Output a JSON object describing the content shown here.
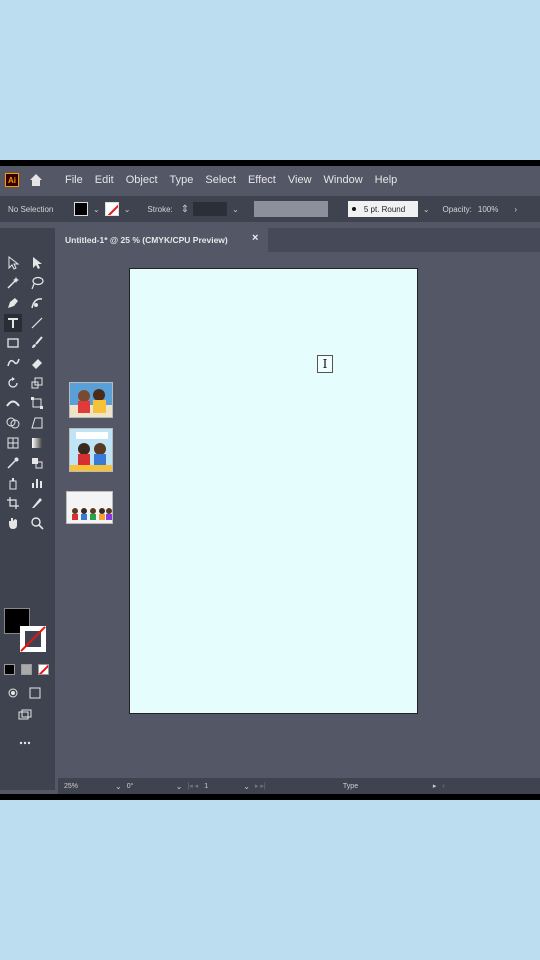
{
  "app": {
    "logo_text": "Ai",
    "menu": [
      "File",
      "Edit",
      "Object",
      "Type",
      "Select",
      "Effect",
      "View",
      "Window",
      "Help"
    ]
  },
  "control_bar": {
    "selection_label": "No Selection",
    "stroke_label": "Stroke:",
    "brush": "5 pt. Round",
    "opacity_label": "Opacity:",
    "opacity_value": "100%"
  },
  "document": {
    "tab_title": "Untitled-1* @ 25 % (CMYK/CPU Preview)",
    "close_glyph": "×"
  },
  "cursor": {
    "glyph": "I"
  },
  "status_bar": {
    "zoom": "25%",
    "rotation": "0°",
    "artboard_number": "1",
    "tool_name": "Type"
  },
  "icons": {
    "home": "home-icon",
    "tools": [
      "selection-tool-icon",
      "direct-selection-tool-icon",
      "magic-wand-icon",
      "lasso-icon",
      "pen-icon",
      "curvature-icon",
      "type-tool-icon",
      "line-tool-icon",
      "rectangle-tool-icon",
      "paintbrush-icon",
      "shaper-icon",
      "eraser-icon",
      "rotate-icon",
      "scale-icon",
      "width-tool-icon",
      "free-transform-icon",
      "shape-builder-icon",
      "perspective-icon",
      "mesh-icon",
      "gradient-icon",
      "eyedropper-icon",
      "blend-icon",
      "symbol-sprayer-icon",
      "graph-icon",
      "artboard-icon",
      "slice-icon",
      "hand-icon",
      "zoom-icon"
    ]
  },
  "colors": {
    "app_bg": "#535766",
    "panel_bg": "#3f4350",
    "artboard": "#e6fdfd",
    "page_bg": "#bcdcf0"
  }
}
